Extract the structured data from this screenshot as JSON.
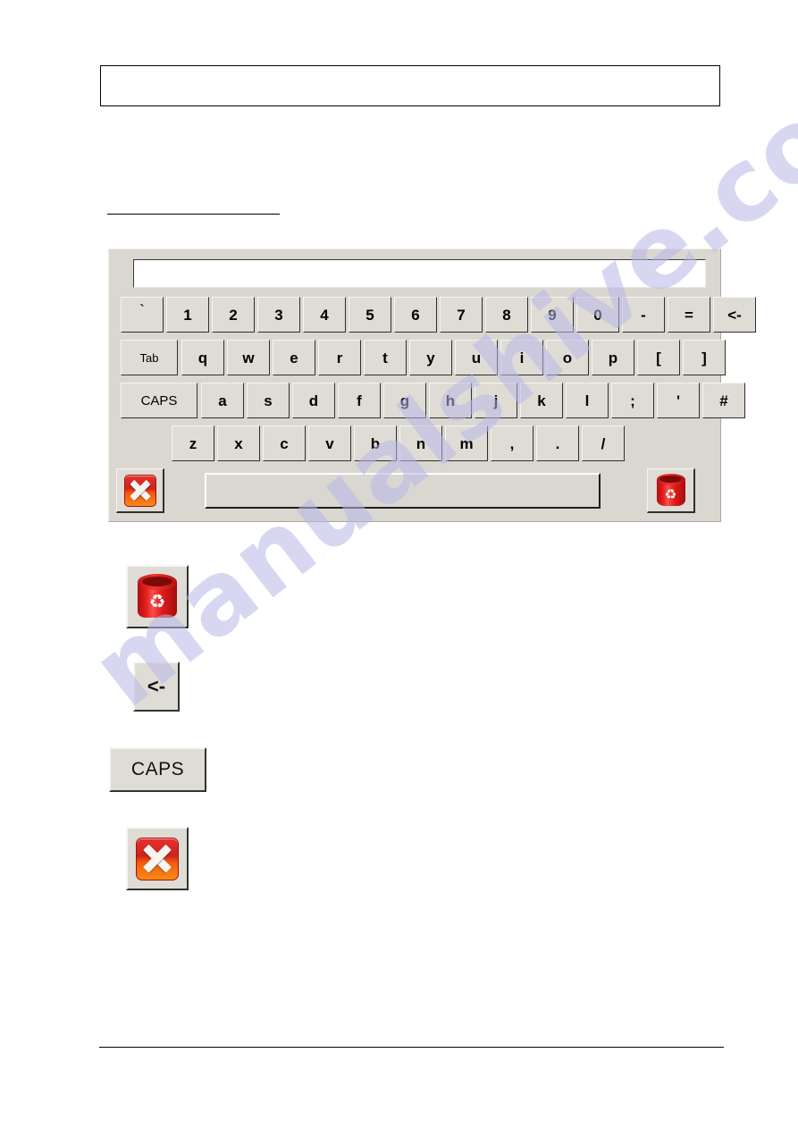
{
  "page": {
    "header_box_text": "",
    "heading_text": "",
    "watermark": "manualshive.com"
  },
  "keyboard": {
    "display_value": "",
    "display_placeholder": "",
    "rows": {
      "number": [
        "`",
        "1",
        "2",
        "3",
        "4",
        "5",
        "6",
        "7",
        "8",
        "9",
        "0",
        "-",
        "=",
        "<-"
      ],
      "top": [
        "Tab",
        "q",
        "w",
        "e",
        "r",
        "t",
        "y",
        "u",
        "i",
        "o",
        "p",
        "[",
        "]"
      ],
      "home": [
        "CAPS",
        "a",
        "s",
        "d",
        "f",
        "g",
        "h",
        "j",
        "k",
        "l",
        ";",
        "'",
        "#"
      ],
      "bottom": [
        "z",
        "x",
        "c",
        "v",
        "b",
        "n",
        "m",
        ",",
        ".",
        "/"
      ]
    },
    "bottom_row": {
      "close_icon": "close-x-icon",
      "spacebar_label": "",
      "clear_icon": "recycle-bin-icon"
    }
  },
  "legend": {
    "items": [
      {
        "icon": "recycle-bin-icon",
        "label": ""
      },
      {
        "icon": "backspace-key",
        "label": "<-"
      },
      {
        "icon": "caps-key",
        "label": "CAPS"
      },
      {
        "icon": "close-x-icon",
        "label": ""
      }
    ]
  },
  "colors": {
    "panel_bg": "#d9d7d0",
    "key_bg": "#dedcd5",
    "key_shadow": "#2f2f2d",
    "accent_red": "#d1211d",
    "accent_orange": "#f98b16",
    "watermark": "#b9b8e8"
  }
}
